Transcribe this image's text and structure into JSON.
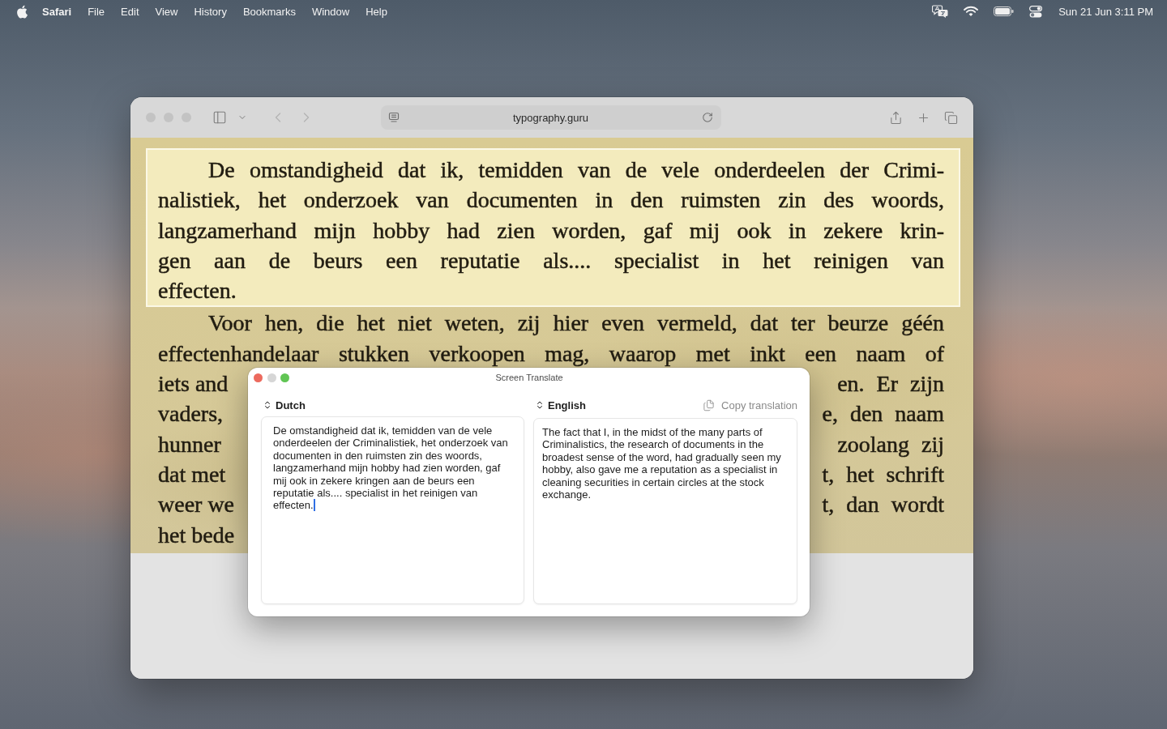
{
  "menu_bar": {
    "app_name": "Safari",
    "menus": [
      "File",
      "Edit",
      "View",
      "History",
      "Bookmarks",
      "Window",
      "Help"
    ],
    "clock": "Sun 21 Jun 3:11 PM"
  },
  "browser": {
    "focused": false,
    "address": "typography.guru",
    "paragraphs": [
      {
        "selected": true,
        "lines": [
          {
            "kind": "full",
            "text": "De omstandigheid dat ik, temidden van de vele onderdeelen der Crimi-"
          },
          {
            "kind": "full",
            "text": "nalistiek, het onderzoek van documenten in den ruimsten zin des woords,"
          },
          {
            "kind": "full",
            "text": "langzamerhand mijn hobby had zien worden, gaf mij ook in zekere krin-"
          },
          {
            "kind": "full",
            "text": "gen aan de beurs een reputatie als.... specialist in het reinigen van"
          },
          {
            "kind": "full",
            "text": "effecten."
          }
        ]
      },
      {
        "selected": false,
        "lines": [
          {
            "kind": "full",
            "text": "Voor hen, die het niet weten, zij hier even vermeld, dat ter beurze géén"
          },
          {
            "kind": "full",
            "text": "effectenhandelaar stukken verkoopen mag, waarop met inkt een naam of"
          },
          {
            "kind": "covered",
            "left": "iets and",
            "right": "en. Er zijn"
          },
          {
            "kind": "covered",
            "left": "vaders,",
            "right": "e, den naam"
          },
          {
            "kind": "covered",
            "left": "hunner",
            "right": "zoolang zij"
          },
          {
            "kind": "covered",
            "left": "dat met",
            "right": "t, het schrift"
          },
          {
            "kind": "covered",
            "left": "weer we",
            "right": "t, dan wordt"
          },
          {
            "kind": "covered",
            "left": "het bede"
          }
        ]
      }
    ]
  },
  "translate_window": {
    "title": "Screen Translate",
    "controls": [
      {
        "kind": "close",
        "disabled": false
      },
      {
        "kind": "minimize",
        "disabled": true
      },
      {
        "kind": "zoom",
        "disabled": false
      }
    ],
    "source": {
      "language": "Dutch",
      "focused": true,
      "text": "De omstandigheid dat ik, temidden van de vele onderdeelen der Criminalistiek, het onderzoek van documenten in den ruimsten zin des woords, langzamerhand mijn hobby had zien worden, gaf mij ook in zekere kringen aan de beurs een reputatie als.... specialist in het reinigen van effecten."
    },
    "target": {
      "language": "English",
      "text": "The fact that I, in the midst of the many parts of Criminalistics, the research of documents in the broadest sense of the word, had gradually seen my hobby, also gave me a reputation as a specialist in cleaning securities in certain circles at the stock exchange."
    },
    "copy_button": "Copy translation"
  }
}
